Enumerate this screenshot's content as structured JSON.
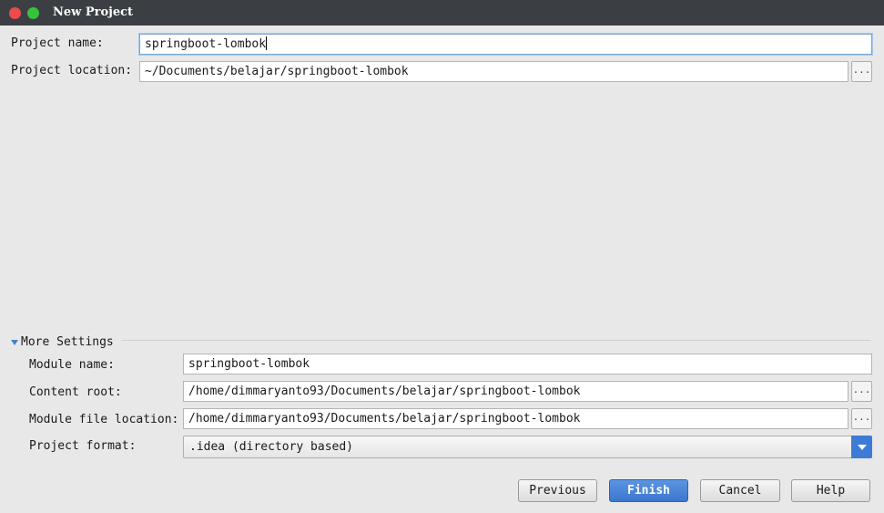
{
  "window": {
    "title": "New Project"
  },
  "project": {
    "name_label": "Project name:",
    "name_value": "springboot-lombok",
    "location_label": "Project location:",
    "location_value": "~/Documents/belajar/springboot-lombok",
    "browse_label": "..."
  },
  "more_settings": {
    "title": "More Settings",
    "module_name_label": "Module name:",
    "module_name_value": "springboot-lombok",
    "content_root_label": "Content root:",
    "content_root_value": "/home/dimmaryanto93/Documents/belajar/springboot-lombok",
    "module_file_label": "Module file location:",
    "module_file_value": "/home/dimmaryanto93/Documents/belajar/springboot-lombok",
    "format_label": "Project format:",
    "format_value": ".idea (directory based)"
  },
  "buttons": {
    "previous": "Previous",
    "finish": "Finish",
    "cancel": "Cancel",
    "help": "Help"
  },
  "colors": {
    "titlebar": "#3b3f44",
    "background": "#e8e8e8",
    "accent": "#3d7bd6",
    "close": "#ee4a4a",
    "maximize": "#35c33d"
  }
}
